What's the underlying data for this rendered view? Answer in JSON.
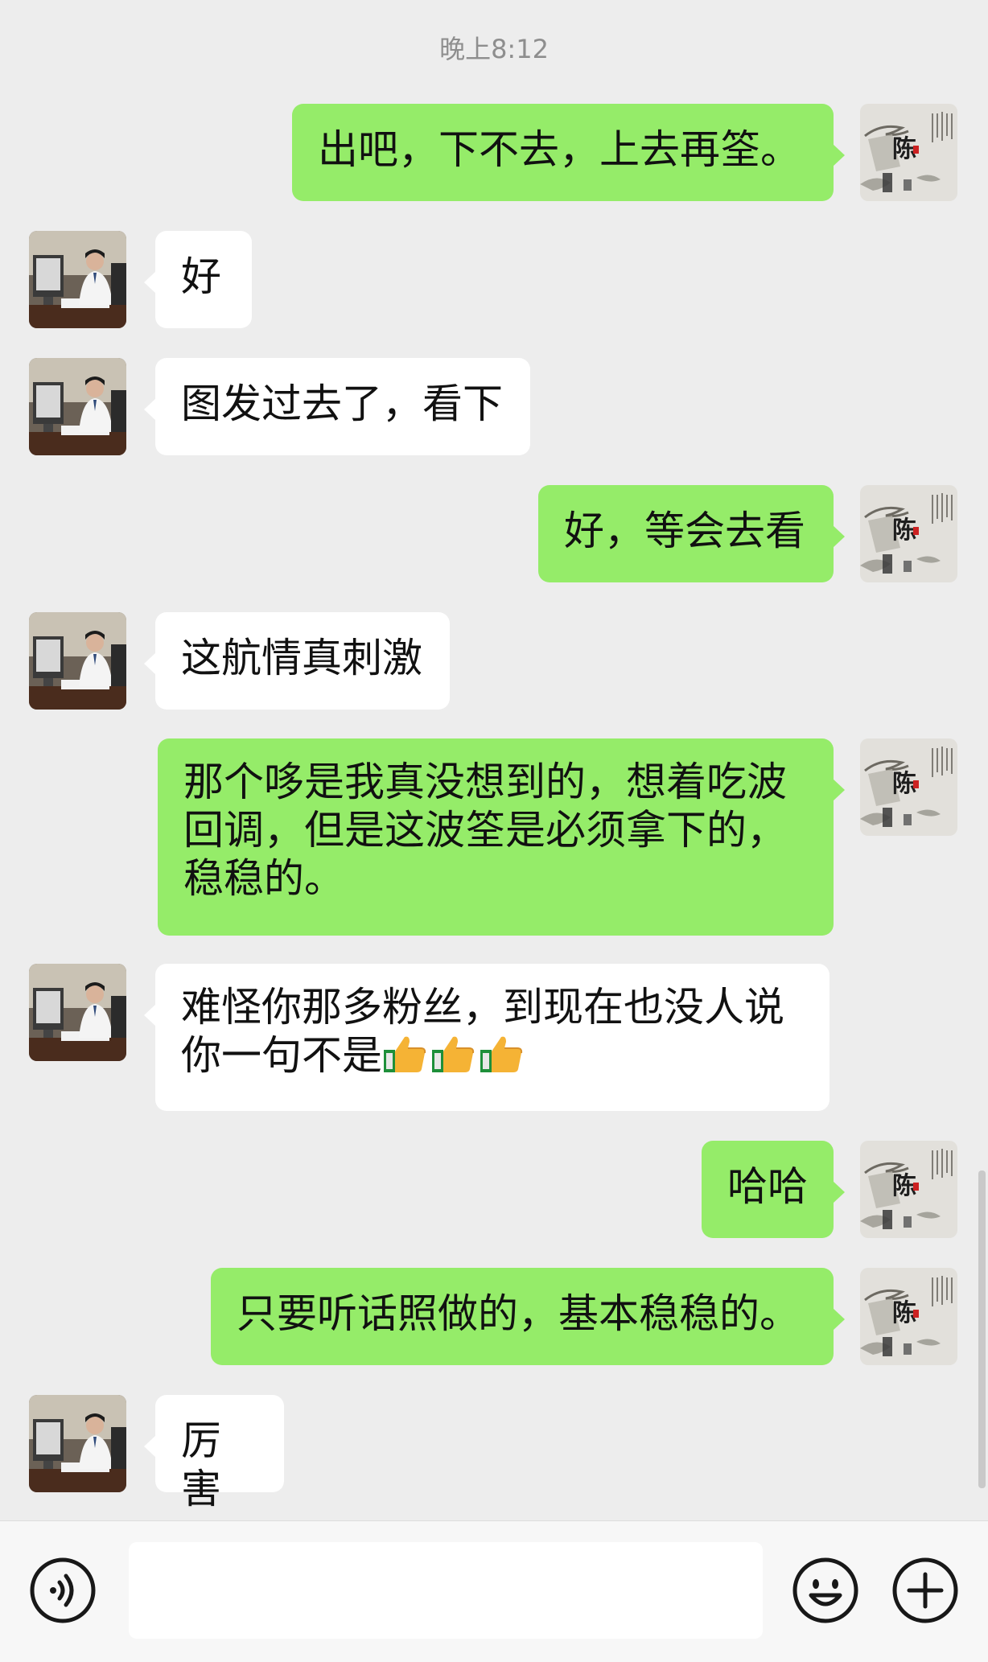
{
  "timestamp": "晚上8:12",
  "messages": [
    {
      "side": "out",
      "text": "出吧，下不去，上去再筌。"
    },
    {
      "side": "in",
      "text": "好"
    },
    {
      "side": "in",
      "text": "图发过去了，看下"
    },
    {
      "side": "out",
      "text": "好，等会去看"
    },
    {
      "side": "in",
      "text": "这航情真刺激"
    },
    {
      "side": "out",
      "lines": [
        "那个哆是我真没想到的，想着吃波",
        "回调，但是这波筌是必须拿下的，",
        "稳稳的。"
      ]
    },
    {
      "side": "in",
      "lines": [
        "难怪你那多粉丝，到现在也没人说",
        "你一句不是"
      ],
      "emoji": [
        "thumbs-up-icon",
        "thumbs-up-icon",
        "thumbs-up-icon"
      ]
    },
    {
      "side": "out",
      "text": "哈哈"
    },
    {
      "side": "out",
      "text": "只要听话照做的，基本稳稳的。"
    },
    {
      "side": "in",
      "text": "厉害"
    }
  ],
  "contact_avatar": {
    "type": "photo",
    "description_icon": "contact-avatar-icon"
  },
  "self_avatar": {
    "type": "calligraphy",
    "character": "陈"
  },
  "input_bar": {
    "voice_icon": "voice-mode-icon",
    "input_value": "",
    "emoji_icon": "emoji-icon",
    "plus_icon": "plus-icon"
  },
  "colors": {
    "background": "#ededed",
    "outgoing_bubble": "#95ec69",
    "incoming_bubble": "#ffffff",
    "timestamp": "#8e8e8e"
  }
}
